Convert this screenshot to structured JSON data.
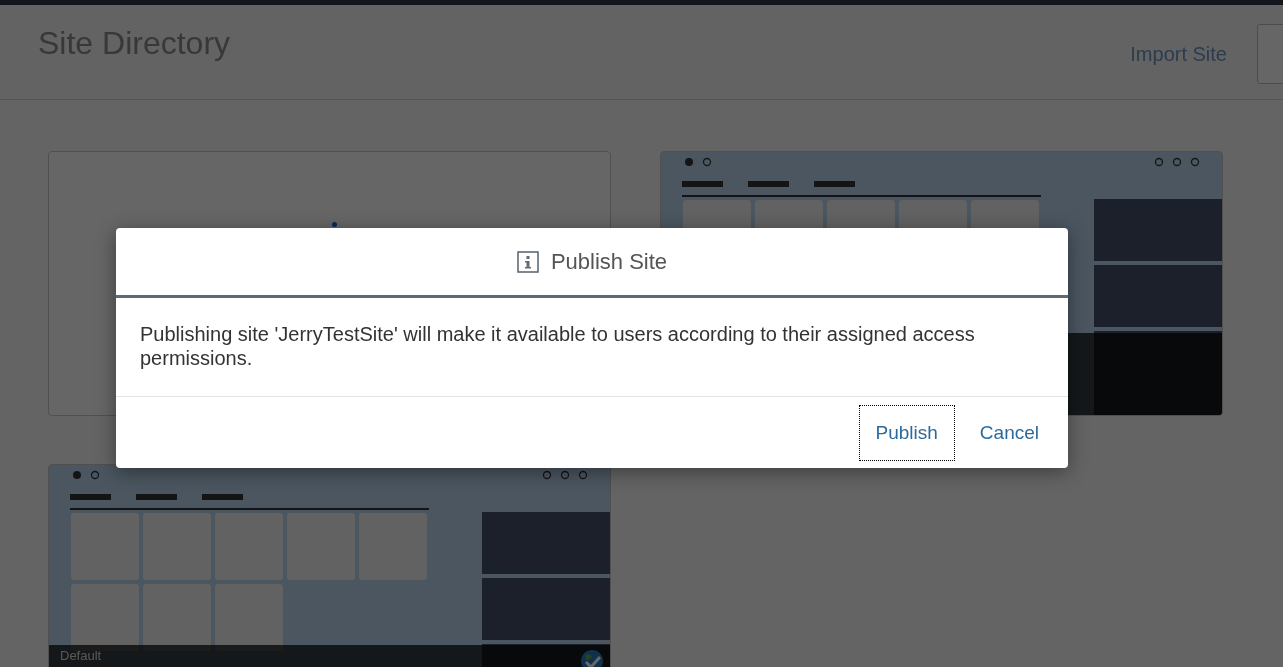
{
  "header": {
    "title": "Site Directory",
    "actions": [
      {
        "kind": "link",
        "label": "Import Site"
      },
      {
        "kind": "outlined"
      }
    ]
  },
  "cards": [
    {
      "kind": "blank",
      "loading": true
    },
    {
      "kind": "preview"
    },
    {
      "kind": "preview",
      "label": "Default",
      "published": true
    }
  ],
  "dialog": {
    "title": "Publish Site",
    "message": "Publishing site 'JerryTestSite' will make it available to users according to their assigned access permissions.",
    "buttons": [
      {
        "label": "Publish",
        "focused": true
      },
      {
        "label": "Cancel",
        "focused": false
      }
    ]
  }
}
